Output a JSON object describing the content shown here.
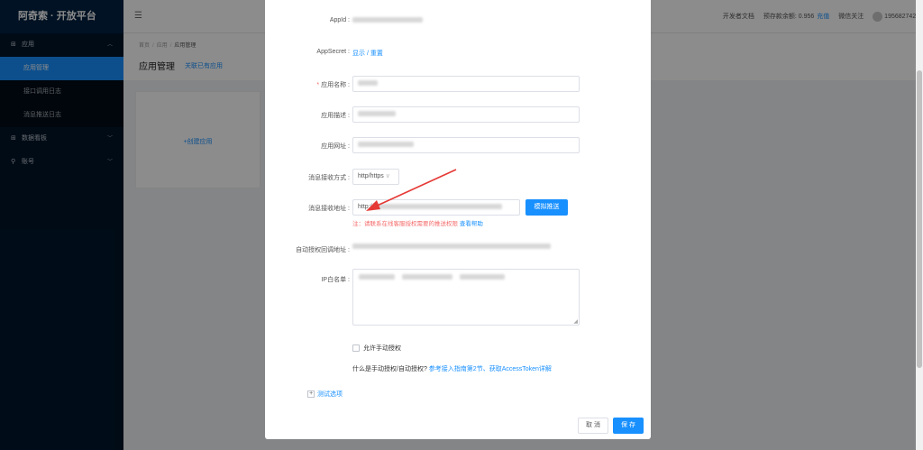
{
  "brand": {
    "title": "阿奇索 · 开放平台"
  },
  "sidebar": {
    "app_group": "应用",
    "app_items": [
      {
        "label": "应用管理"
      },
      {
        "label": "接口调用日志"
      },
      {
        "label": "消息推送日志"
      }
    ],
    "dashboard_group": "数据看板",
    "account_group": "账号"
  },
  "topbar": {
    "docs": "开发者文档",
    "balance_label": "预存款余额: 0.956",
    "recharge": "充值",
    "wechat": "微信关注",
    "user_id": "19568274280"
  },
  "breadcrumb": {
    "home": "首页",
    "app": "应用",
    "current": "应用管理"
  },
  "page": {
    "title": "应用管理",
    "subtitle": "关联已有应用",
    "create_app": "+创建应用"
  },
  "dialog": {
    "appid_label": "AppId :",
    "secret_label": "AppSecret :",
    "secret_show": "显示",
    "secret_sep": "/",
    "secret_reset": "重置",
    "app_name_label": "应用名称 :",
    "app_desc_label": "应用描述 :",
    "app_url_label": "应用网址 :",
    "receive_mode_label": "消息接收方式 :",
    "receive_mode_value": "http/https",
    "receive_url_label": "消息接收地址 :",
    "receive_url_value": "http://",
    "simulate_push": "模拟推送",
    "notice_text": "注：请联系在线客服授权需要的推送权限",
    "notice_help": "查看帮助",
    "auth_callback_label": "自动授权回调地址 :",
    "ip_whitelist_label": "IP白名单 :",
    "manual_auth_label": "允许手动授权",
    "help_question": "什么是手动授权/自动授权?",
    "help_link": "参考接入指南第2节、获取AccessToken详解",
    "test_options": "测试选项",
    "cancel": "取 消",
    "save": "保 存"
  }
}
